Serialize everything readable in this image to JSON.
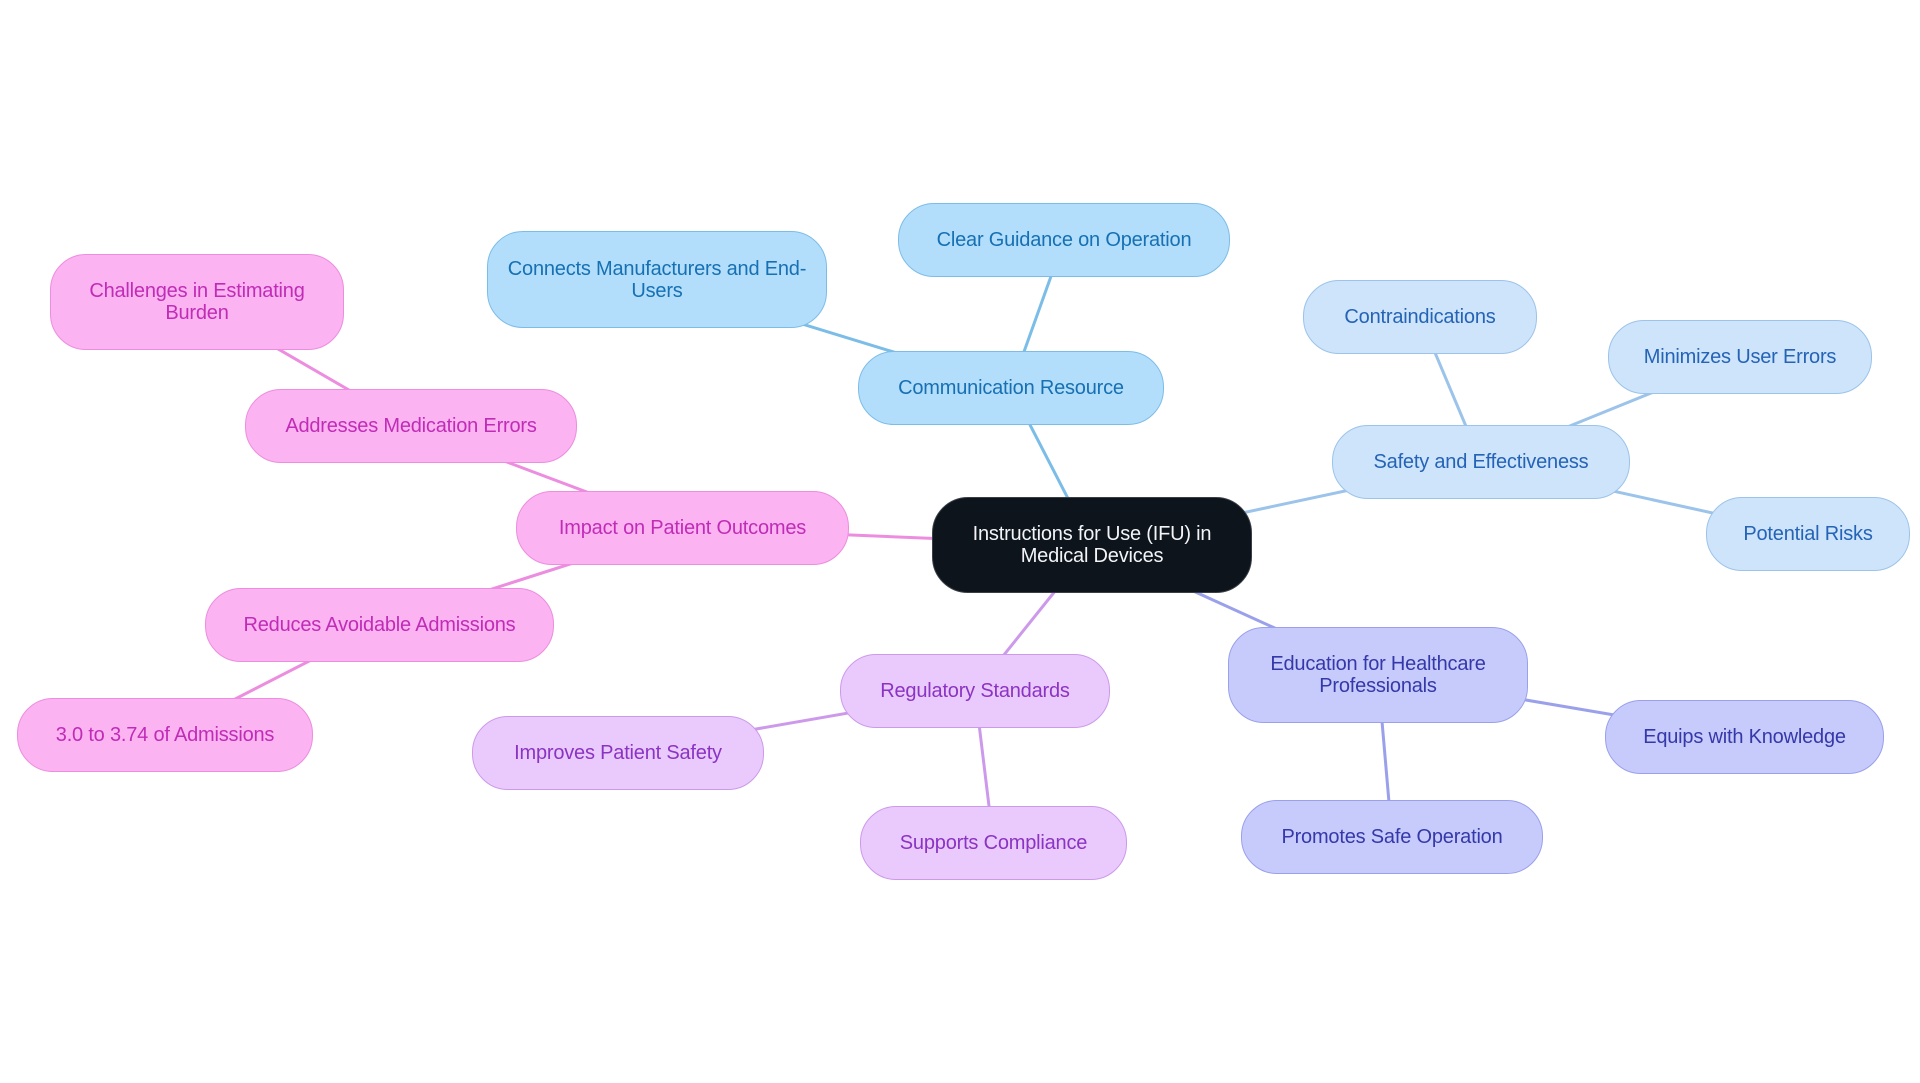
{
  "root": {
    "label": "Instructions for Use (IFU) in Medical Devices"
  },
  "branches": {
    "communication": {
      "label": "Communication Resource",
      "color": "#7cbde8",
      "children": [
        "Clear Guidance on Operation",
        "Connects Manufacturers and End-Users"
      ]
    },
    "safety": {
      "label": "Safety and Effectiveness",
      "color": "#9cc3ea",
      "children": [
        "Contraindications",
        "Minimizes User Errors",
        "Potential Risks"
      ]
    },
    "education": {
      "label": "Education for Healthcare Professionals",
      "color": "#9aa0ea",
      "children": [
        "Equips with Knowledge",
        "Promotes Safe Operation"
      ]
    },
    "regulatory": {
      "label": "Regulatory Standards",
      "color": "#cd99ea",
      "children": [
        "Improves Patient Safety",
        "Supports Compliance"
      ]
    },
    "impact": {
      "label": "Impact on Patient Outcomes",
      "color": "#ec8ddf",
      "children": [
        "Addresses Medication Errors",
        "Reduces Avoidable Admissions"
      ],
      "grandchildren": {
        "medication_errors": [
          "Challenges in Estimating Burden"
        ],
        "avoidable_admissions": [
          "3.0 to 3.74 of Admissions"
        ]
      }
    }
  }
}
